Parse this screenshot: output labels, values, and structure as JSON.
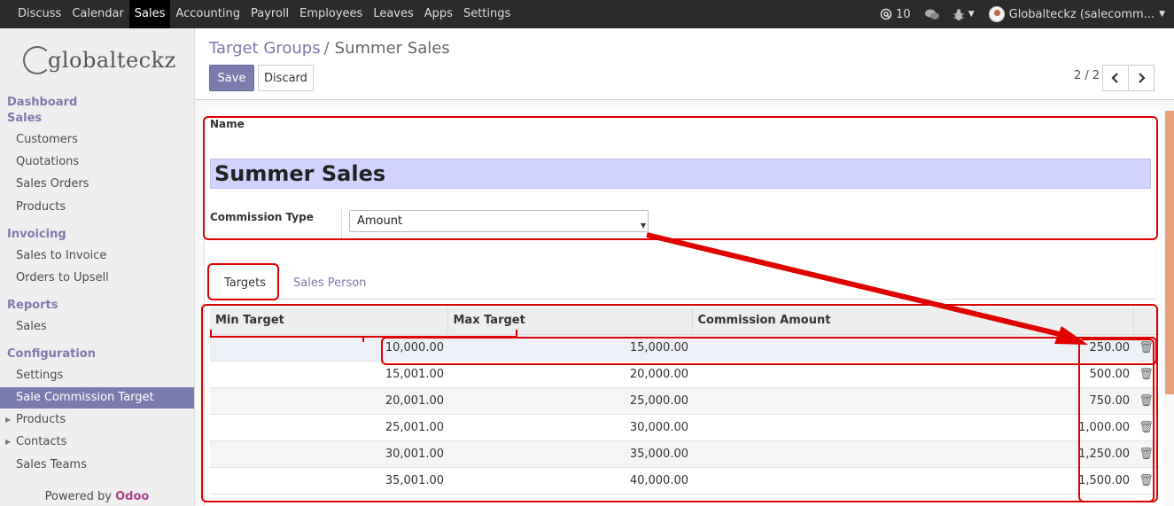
{
  "topbar": {
    "menu": [
      "Discuss",
      "Calendar",
      "Sales",
      "Accounting",
      "Payroll",
      "Employees",
      "Leaves",
      "Apps",
      "Settings"
    ],
    "active_menu": "Sales",
    "notifications": "10",
    "user": "Globalteckz (salecomm..."
  },
  "sidebar": {
    "logo": "globalteckz",
    "sections": [
      {
        "label": "Dashboard"
      },
      {
        "label": "Sales",
        "items": [
          "Customers",
          "Quotations",
          "Sales Orders",
          "Products"
        ]
      },
      {
        "label": "Invoicing",
        "items": [
          "Sales to Invoice",
          "Orders to Upsell"
        ]
      },
      {
        "label": "Reports",
        "items": [
          "Sales"
        ]
      },
      {
        "label": "Configuration",
        "items": [
          "Settings",
          "Sale Commission Target",
          "Products",
          "Contacts",
          "Sales Teams"
        ]
      }
    ],
    "active_item": "Sale Commission Target",
    "powered_prefix": "Powered by",
    "powered_brand": "Odoo"
  },
  "control_panel": {
    "breadcrumb_parent": "Target Groups",
    "breadcrumb_separator": "/",
    "breadcrumb_current": "Summer Sales",
    "save_label": "Save",
    "discard_label": "Discard",
    "pager": "2 / 2"
  },
  "form": {
    "name_label": "Name",
    "name_value": "Summer Sales",
    "commission_type_label": "Commission Type",
    "commission_type_value": "Amount"
  },
  "tabs": [
    {
      "label": "Targets",
      "active": true
    },
    {
      "label": "Sales Person",
      "active": false
    }
  ],
  "targets_table": {
    "columns": [
      "Min Target",
      "Max Target",
      "Commission Amount"
    ],
    "rows": [
      [
        "10,000.00",
        "15,000.00",
        "250.00"
      ],
      [
        "15,001.00",
        "20,000.00",
        "500.00"
      ],
      [
        "20,001.00",
        "25,000.00",
        "750.00"
      ],
      [
        "25,001.00",
        "30,000.00",
        "1,000.00"
      ],
      [
        "30,001.00",
        "35,000.00",
        "1,250.00"
      ],
      [
        "35,001.00",
        "40,000.00",
        "1,500.00"
      ]
    ]
  },
  "colors": {
    "brand": "#7c7bad",
    "topbar": "#2b2b2b",
    "annotation": "#e00000",
    "name_field": "#d2d2ff"
  },
  "icons": {
    "mention": "at-icon",
    "chat": "chat-bubbles-icon",
    "debug": "bug-icon",
    "delete": "trash-icon",
    "prev": "chevron-left-icon",
    "next": "chevron-right-icon"
  }
}
